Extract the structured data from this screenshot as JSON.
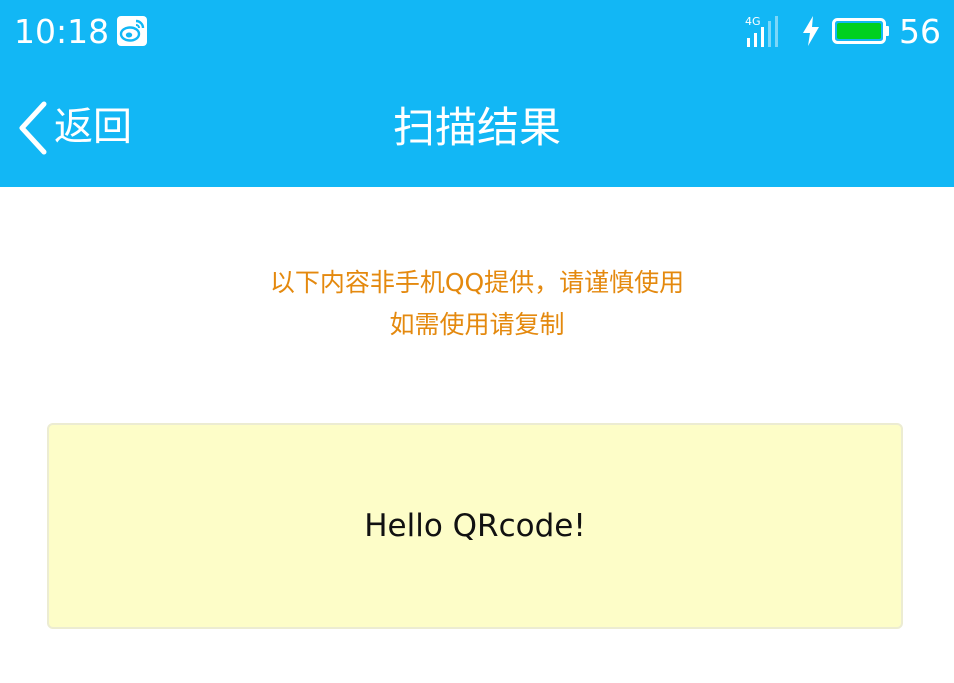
{
  "status_bar": {
    "time": "10:18",
    "network": "4G",
    "battery_level": "56",
    "icons": [
      "weibo-icon",
      "signal-4g-icon",
      "charging-bolt-icon",
      "battery-icon"
    ]
  },
  "nav": {
    "back_label": "返回",
    "title": "扫描结果"
  },
  "notice": {
    "line1": "以下内容非手机QQ提供，请谨慎使用",
    "line2": "如需使用请复制"
  },
  "result": {
    "text": "Hello QRcode!"
  },
  "colors": {
    "header_bg": "#12b7f5",
    "notice_text": "#e4890e",
    "result_bg": "#fdfdc8",
    "battery_fill": "#00d020"
  }
}
